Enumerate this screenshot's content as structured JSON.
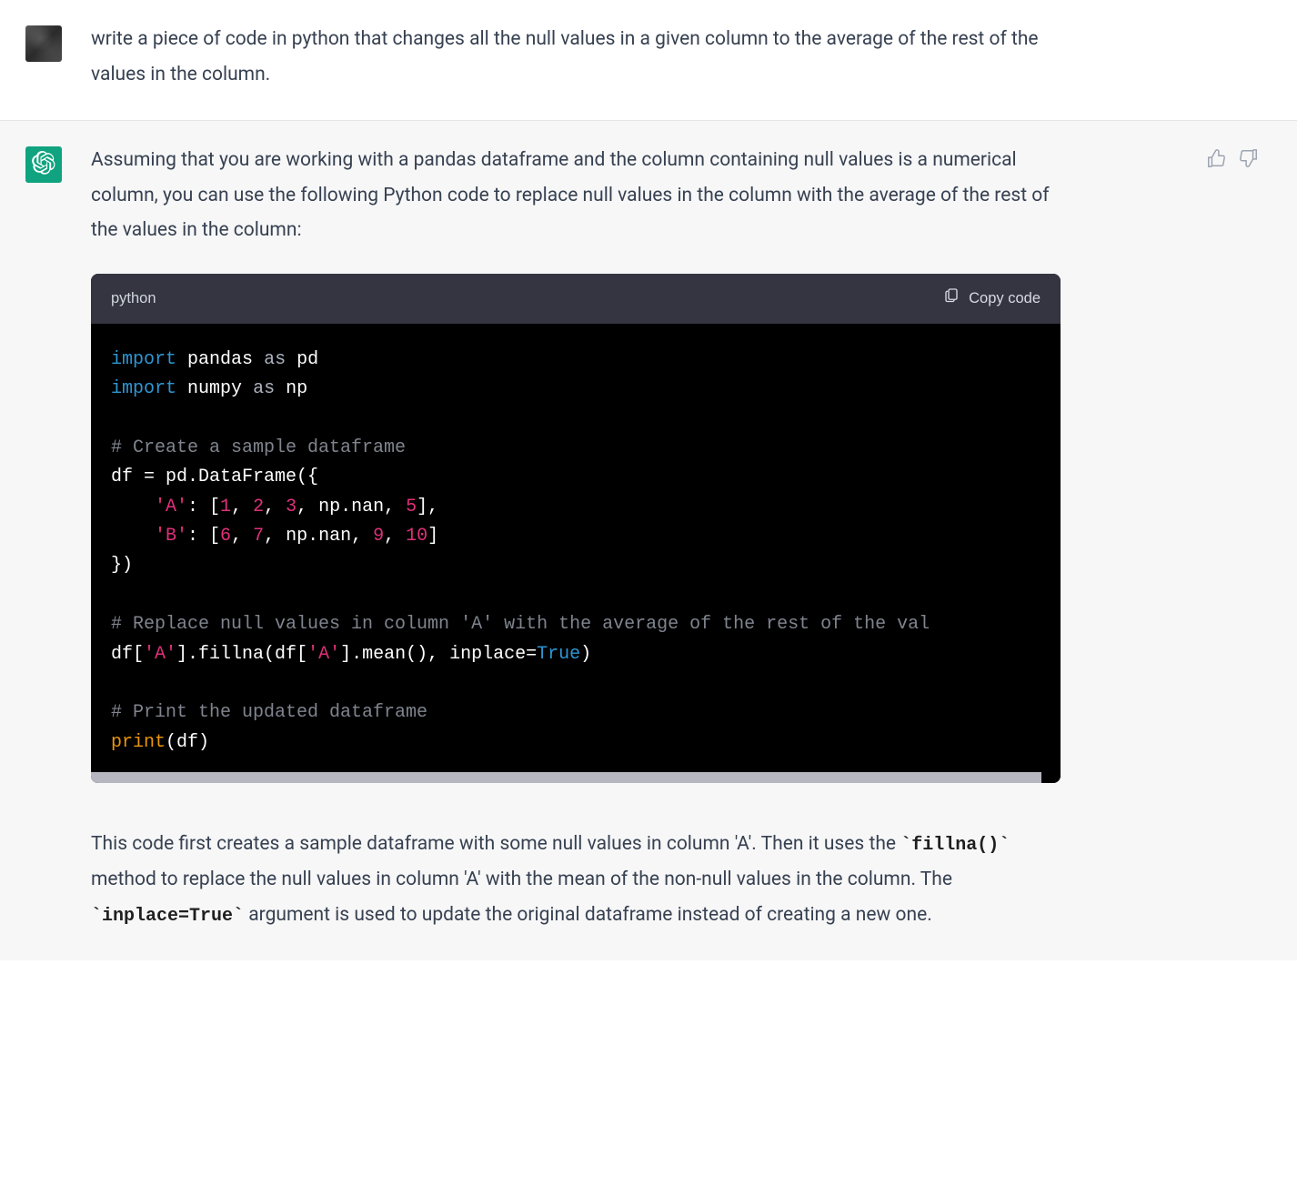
{
  "user_message": "write a piece of code in python that changes all the null values in a given column to the average of the rest of the values in the column.",
  "assistant_intro": "Assuming that you are working with a pandas dataframe and the column containing null values is a numerical column, you can use the following Python code to replace null values in the column with the average of the rest of the values in the column:",
  "code_lang": "python",
  "copy_label": "Copy code",
  "code_tokens": [
    [
      [
        "kw",
        "import"
      ],
      [
        "sp",
        " "
      ],
      [
        "id",
        "pandas"
      ],
      [
        "sp",
        " "
      ],
      [
        "as",
        "as"
      ],
      [
        "sp",
        " "
      ],
      [
        "id",
        "pd"
      ]
    ],
    [
      [
        "kw",
        "import"
      ],
      [
        "sp",
        " "
      ],
      [
        "id",
        "numpy"
      ],
      [
        "sp",
        " "
      ],
      [
        "as",
        "as"
      ],
      [
        "sp",
        " "
      ],
      [
        "id",
        "np"
      ]
    ],
    [],
    [
      [
        "cmt",
        "# Create a sample dataframe"
      ]
    ],
    [
      [
        "id",
        "df = pd.DataFrame({"
      ]
    ],
    [
      [
        "id",
        "    "
      ],
      [
        "str",
        "'A'"
      ],
      [
        "id",
        ": ["
      ],
      [
        "num",
        "1"
      ],
      [
        "id",
        ", "
      ],
      [
        "num",
        "2"
      ],
      [
        "id",
        ", "
      ],
      [
        "num",
        "3"
      ],
      [
        "id",
        ", np.nan, "
      ],
      [
        "num",
        "5"
      ],
      [
        "id",
        "],"
      ]
    ],
    [
      [
        "id",
        "    "
      ],
      [
        "str",
        "'B'"
      ],
      [
        "id",
        ": ["
      ],
      [
        "num",
        "6"
      ],
      [
        "id",
        ", "
      ],
      [
        "num",
        "7"
      ],
      [
        "id",
        ", np.nan, "
      ],
      [
        "num",
        "9"
      ],
      [
        "id",
        ", "
      ],
      [
        "num",
        "10"
      ],
      [
        "id",
        "]"
      ]
    ],
    [
      [
        "id",
        "})"
      ]
    ],
    [],
    [
      [
        "cmt",
        "# Replace null values in column 'A' with the average of the rest of the val"
      ]
    ],
    [
      [
        "id",
        "df["
      ],
      [
        "str",
        "'A'"
      ],
      [
        "id",
        "].fillna(df["
      ],
      [
        "str",
        "'A'"
      ],
      [
        "id",
        "].mean(), inplace="
      ],
      [
        "bool",
        "True"
      ],
      [
        "id",
        ")"
      ]
    ],
    [],
    [
      [
        "cmt",
        "# Print the updated dataframe"
      ]
    ],
    [
      [
        "fn",
        "print"
      ],
      [
        "id",
        "(df)"
      ]
    ]
  ],
  "assistant_outro_parts": [
    {
      "t": "text",
      "v": "This code first creates a sample dataframe with some null values in column 'A'. Then it uses the "
    },
    {
      "t": "code",
      "v": "`fillna()`"
    },
    {
      "t": "text",
      "v": " method to replace the null values in column 'A' with the mean of the non-null values in the column. The "
    },
    {
      "t": "code",
      "v": "`inplace=True`"
    },
    {
      "t": "text",
      "v": " argument is used to update the original dataframe instead of creating a new one."
    }
  ]
}
